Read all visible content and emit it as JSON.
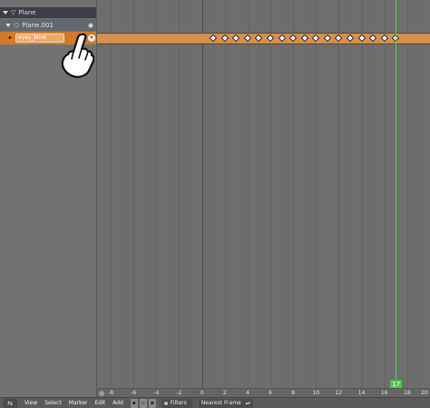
{
  "channels": {
    "object": {
      "name": "Plane",
      "icon": "triangle-object-icon"
    },
    "mesh": {
      "name": "Plane.001",
      "icon": "mesh-data-icon",
      "visibility_icon": "visibility-icon"
    },
    "action": {
      "name": "eyes_blink",
      "icon": "action-icon",
      "button_icon": "browse-action-icon"
    }
  },
  "timeline": {
    "current_frame": "17",
    "origin_frame": 0,
    "frame_min": -9.2,
    "frame_max": 20,
    "keyframes": [
      1,
      2,
      3,
      4,
      5,
      6,
      7,
      8,
      9,
      10,
      11,
      12,
      13,
      14,
      15,
      16,
      17
    ],
    "ticks": [
      {
        "frame": -8,
        "label": "-8"
      },
      {
        "frame": -6,
        "label": "-6"
      },
      {
        "frame": -4,
        "label": "-4"
      },
      {
        "frame": -2,
        "label": "-2"
      },
      {
        "frame": 0,
        "label": "0"
      },
      {
        "frame": 2,
        "label": "2"
      },
      {
        "frame": 4,
        "label": "4"
      },
      {
        "frame": 6,
        "label": "6"
      },
      {
        "frame": 8,
        "label": "8"
      },
      {
        "frame": 10,
        "label": "10"
      },
      {
        "frame": 12,
        "label": "12"
      },
      {
        "frame": 14,
        "label": "14"
      },
      {
        "frame": 16,
        "label": "16"
      },
      {
        "frame": 18,
        "label": "18"
      },
      {
        "frame": 20,
        "label": "20"
      }
    ]
  },
  "header": {
    "editor_icon": "dope-sheet-editor-icon",
    "menus": [
      "View",
      "Select",
      "Marker",
      "Edit",
      "Add"
    ],
    "filters_label": "Filters",
    "snap_mode": "Nearest Frame"
  },
  "cursor": {
    "icon": "pointing-hand-icon"
  },
  "colors": {
    "accent": "#d27a27",
    "current_frame": "#52d452"
  }
}
